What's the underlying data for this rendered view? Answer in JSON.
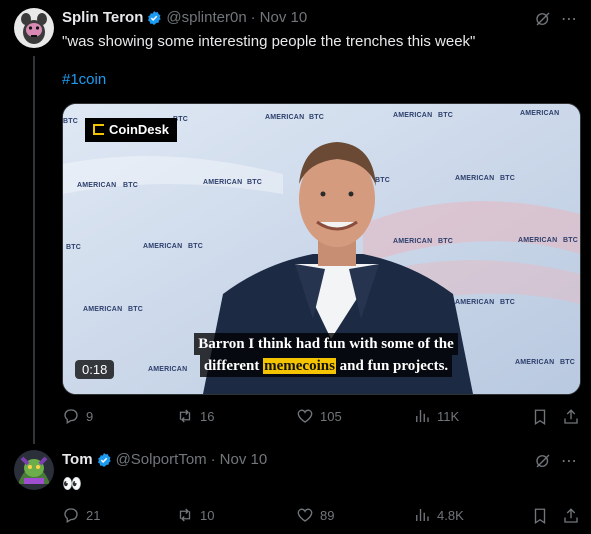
{
  "tweet1": {
    "display_name": "Splin Teron",
    "handle": "@splinter0n",
    "date_sep": "·",
    "date": "Nov 10",
    "text": "\"was showing some interesting people the trenches this week\"",
    "hashtag": "#1coin",
    "media": {
      "brand": "CoinDesk",
      "backdrop_label": "AMERICAN",
      "backdrop_label2": "BTC",
      "caption_line1": "Barron I think had fun with some of the",
      "caption_pre": "different",
      "caption_highlight": "memecoins",
      "caption_post": "and fun projects.",
      "duration": "0:18"
    },
    "stats": {
      "replies": "9",
      "reposts": "16",
      "likes": "105",
      "views": "11K"
    }
  },
  "tweet2": {
    "display_name": "Tom",
    "handle": "@SolportTom",
    "date_sep": "·",
    "date": "Nov 10",
    "text": "👀",
    "stats": {
      "replies": "21",
      "reposts": "10",
      "likes": "89",
      "views": "4.8K"
    }
  },
  "colors": {
    "background": "#000000",
    "text": "#e7e9ea",
    "muted": "#71767b",
    "accent": "#1d9bf0",
    "highlight": "#f5c400"
  }
}
